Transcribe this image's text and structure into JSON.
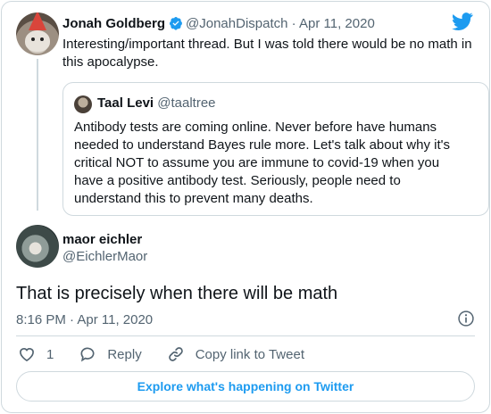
{
  "parent_tweet": {
    "author_name": "Jonah Goldberg",
    "handle": "@JonahDispatch",
    "separator": "·",
    "date": "Apr 11, 2020",
    "text": "Interesting/important thread. But I was told there would be no math in this apocalypse."
  },
  "quoted_tweet": {
    "author_name": "Taal Levi",
    "handle": "@taaltree",
    "text": "Antibody tests are coming online. Never before have humans needed to understand Bayes rule more. Let's talk about why it's critical NOT to assume you are immune to covid-19 when you have a positive antibody test. Seriously, people need to understand this to prevent many deaths."
  },
  "main_tweet": {
    "author_name": "maor eichler",
    "handle": "@EichlerMaor",
    "text": "That is precisely when there will be math",
    "timestamp": "8:16 PM · Apr 11, 2020"
  },
  "actions": {
    "like_count": "1",
    "reply_label": "Reply",
    "copy_link_label": "Copy link to Tweet"
  },
  "explore_label": "Explore what's happening on Twitter",
  "colors": {
    "brand_blue": "#1d9bf0",
    "text_primary": "#0f1419",
    "text_secondary": "#536471",
    "border": "#cfd9de"
  },
  "icons": [
    "twitter-bird-icon",
    "verified-badge-icon",
    "info-icon",
    "heart-icon",
    "reply-icon",
    "link-icon"
  ]
}
